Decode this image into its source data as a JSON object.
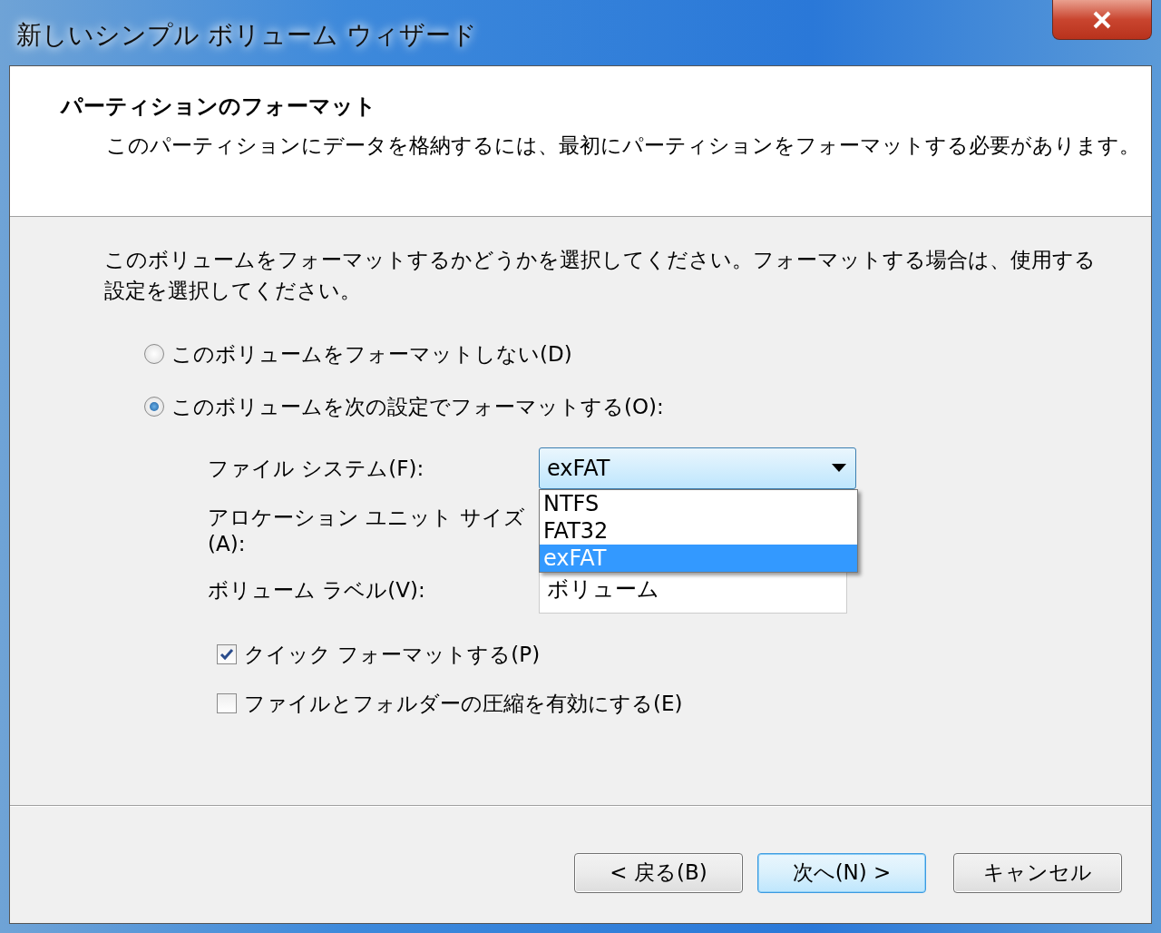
{
  "window": {
    "title": "新しいシンプル ボリューム ウィザード"
  },
  "header": {
    "title": "パーティションのフォーマット",
    "description": "このパーティションにデータを格納するには、最初にパーティションをフォーマットする必要があります。"
  },
  "intro": "このボリュームをフォーマットするかどうかを選択してください。フォーマットする場合は、使用する設定を選択してください。",
  "options": [
    {
      "label": "このボリュームをフォーマットしない(D)",
      "selected": false
    },
    {
      "label": "このボリュームを次の設定でフォーマットする(O):",
      "selected": true
    }
  ],
  "settings": {
    "file_system": {
      "label": "ファイル システム(F):",
      "value": "exFAT",
      "expanded": true,
      "options": [
        {
          "label": "NTFS",
          "selected": false
        },
        {
          "label": "FAT32",
          "selected": false
        },
        {
          "label": "exFAT",
          "selected": true
        }
      ]
    },
    "allocation_unit_size": {
      "label": "アロケーション ユニット サイズ(A):"
    },
    "volume_label": {
      "label": "ボリューム ラベル(V):",
      "value": "ボリューム"
    }
  },
  "checkboxes": [
    {
      "label": "クイック フォーマットする(P)",
      "checked": true
    },
    {
      "label": "ファイルとフォルダーの圧縮を有効にする(E)",
      "checked": false
    }
  ],
  "buttons": [
    {
      "label": "< 戻る(B)",
      "default": false
    },
    {
      "label": "次へ(N) >",
      "default": true
    },
    {
      "label": "キャンセル",
      "default": false
    }
  ]
}
